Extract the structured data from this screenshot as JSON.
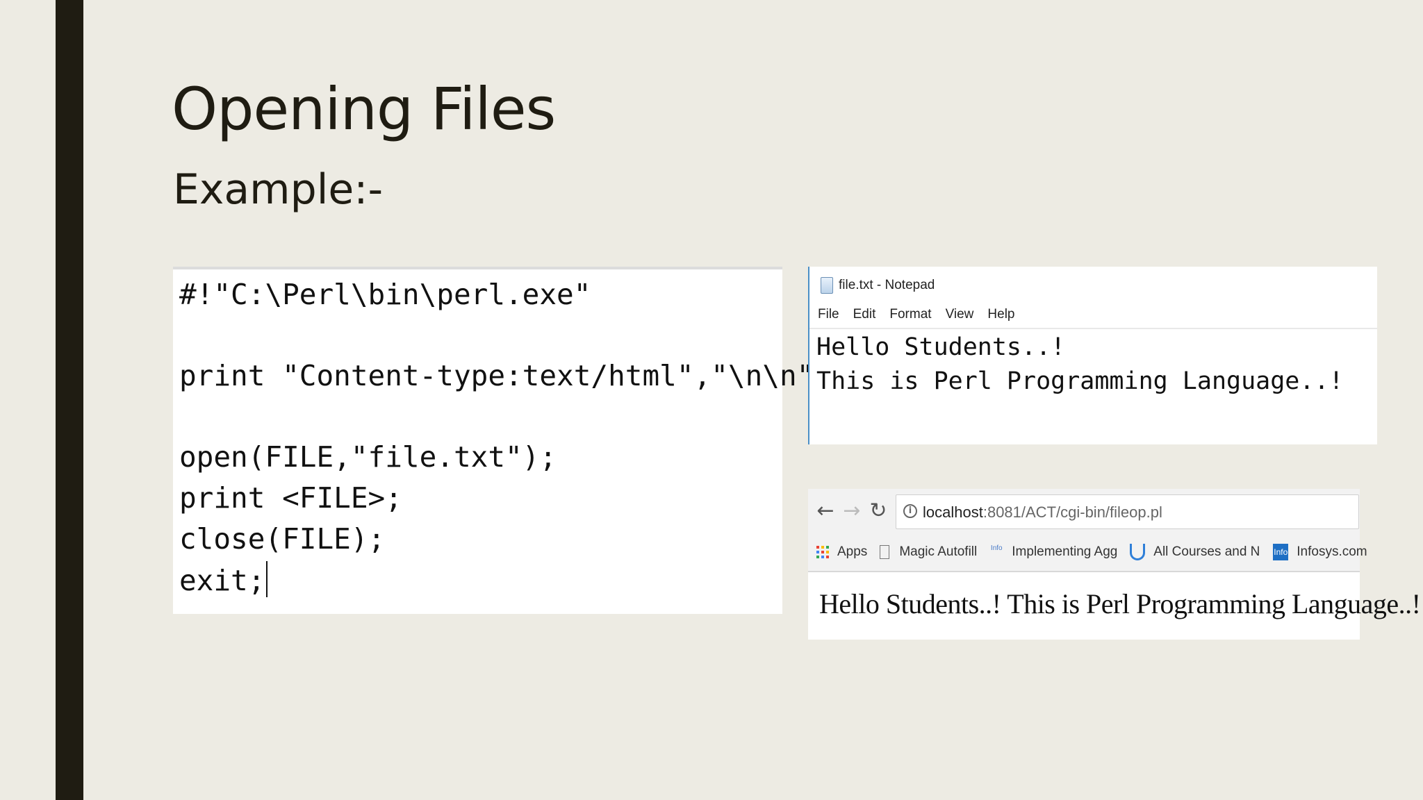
{
  "slide": {
    "title": "Opening Files",
    "subtitle": "Example:-"
  },
  "code": {
    "lines": [
      "#!\"C:\\Perl\\bin\\perl.exe\"",
      "print \"Content-type:text/html\",\"\\n\\n\";",
      "open(FILE,\"file.txt\");",
      "print <FILE>;",
      "close(FILE);",
      "exit;"
    ]
  },
  "notepad": {
    "title": "file.txt - Notepad",
    "menu": [
      "File",
      "Edit",
      "Format",
      "View",
      "Help"
    ],
    "lines": [
      "Hello Students..!",
      "This is Perl Programming Language..!"
    ]
  },
  "browser": {
    "url_host": "localhost",
    "url_rest": ":8081/ACT/cgi-bin/fileop.pl",
    "bookmarks": [
      {
        "label": "Apps",
        "icon": "apps-icon"
      },
      {
        "label": "Magic Autofill",
        "icon": "page-icon"
      },
      {
        "label": "Implementing Aggreg",
        "icon": "info-icon"
      },
      {
        "label": "All Courses and Nanc",
        "icon": "udacity-icon"
      },
      {
        "label": "Infosys.com",
        "icon": "infosys-icon"
      }
    ],
    "info_badge": "Info",
    "infy_badge": "Info",
    "content": "Hello Students..! This is Perl Programming Language..!"
  }
}
